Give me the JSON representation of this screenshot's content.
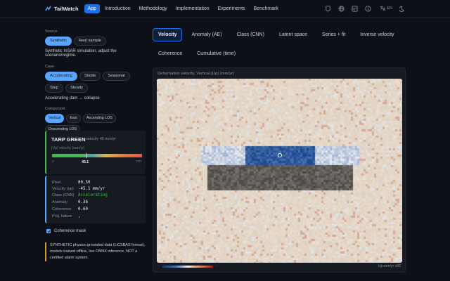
{
  "nav": {
    "brand": "TailWatch",
    "links": [
      "App",
      "Introduction",
      "Methodology",
      "Implementation",
      "Experiments",
      "Benchmark"
    ],
    "active": "App",
    "icons": [
      "github-icon",
      "globe-icon",
      "grid-icon",
      "info-icon",
      "translate-icon",
      "moon-icon"
    ],
    "lang": "EN"
  },
  "sidebar": {
    "source_label": "Source",
    "source_options": [
      "Synthetic",
      "Real sample"
    ],
    "source_selected": "Synthetic",
    "source_note": "Synthetic InSAR simulation; adjust the scenario/regime.",
    "case_label": "Case",
    "case_options": [
      "Accelerating",
      "Stable",
      "Seasonal",
      "Step",
      "Steady"
    ],
    "case_selected": "Accelerating",
    "case_note": "Accelerating dam → collapse",
    "component_label": "Component",
    "component_options": [
      "Vertical",
      "East",
      "Ascending LOS",
      "Descending LOS"
    ],
    "component_selected": "Vertical"
  },
  "tarp": {
    "title": "TARP GREEN",
    "subtitle": "velocity 45 mm/yr",
    "unit": "|Up| velocity (mm/yr)",
    "min": "0",
    "value": "45.1",
    "value_num": 45.1,
    "max": "120",
    "max_num": 120
  },
  "info": {
    "rows": [
      {
        "label": "Pixel",
        "value": "80,50"
      },
      {
        "label": "Velocity (up)",
        "value": "-45.1 mm/yr"
      },
      {
        "label": "Class (CNN)",
        "value": "Accelerating"
      },
      {
        "label": "Anomaly",
        "value": "0.36"
      },
      {
        "label": "Coherence",
        "value": "0.60"
      },
      {
        "label": "Proj. failure",
        "value": ","
      }
    ]
  },
  "coherence_mask": {
    "label": "Coherence mask",
    "checked": true
  },
  "warning": "SYNTHETIC physics-grounded data (LiCSBAS format); models trained offline, live ONNX inference. NOT a certified alarm system.",
  "tabs": {
    "items": [
      "Velocity",
      "Anomaly (AE)",
      "Class (CNN)",
      "Latent space",
      "Series + fit",
      "Inverse velocity",
      "Coherence",
      "Cumulative (time)"
    ],
    "active": "Velocity"
  },
  "plot": {
    "title": "Deformation velocity, Vertical (Up) (mm/yr)",
    "colorbar_left": "←",
    "colorbar_right": "→",
    "unit_label": "Up mm/yr x60",
    "colors": {
      "negative": "#1f4f94",
      "neutral": "#efe4d6",
      "positive": "#c9a084",
      "masked": "#5f5a55"
    }
  }
}
